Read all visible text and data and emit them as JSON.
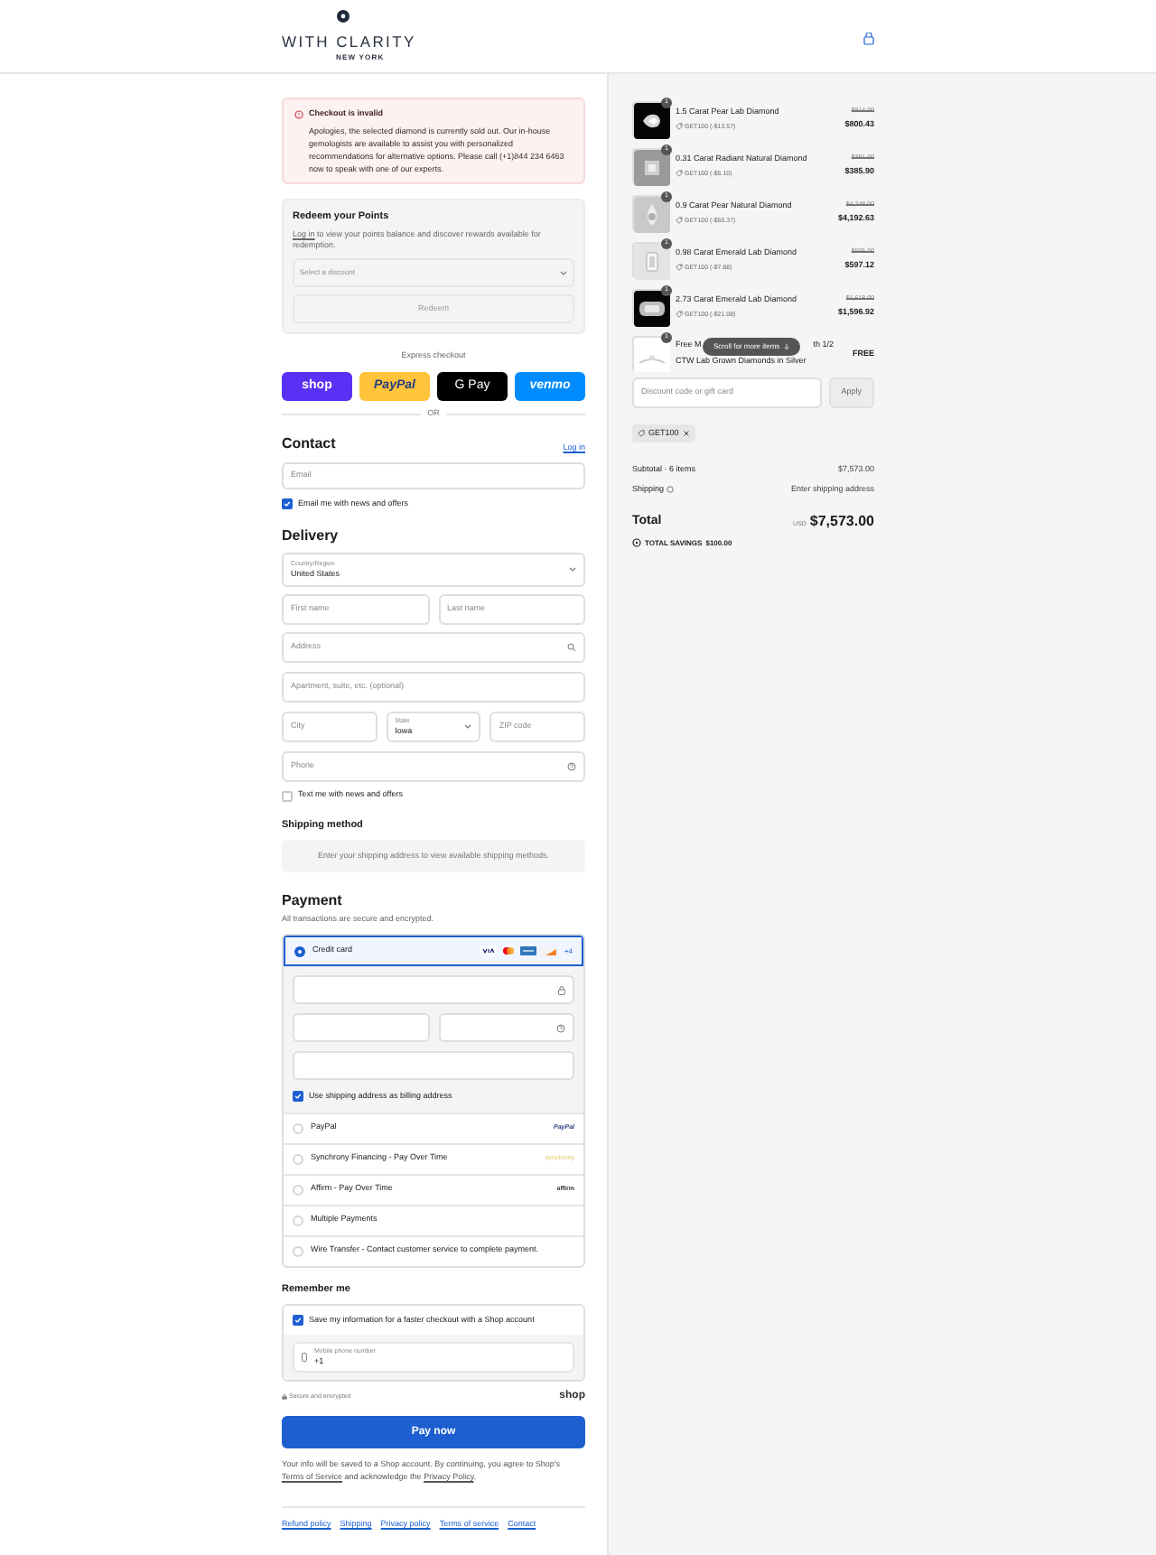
{
  "header": {
    "brand": "WITH CLARITY",
    "tagline": "NEW YORK"
  },
  "alert": {
    "title": "Checkout is invalid",
    "message": "Apologies, the selected diamond is currently sold out. Our in-house gemologists are available to assist you with personalized recommendations for alternative options. Please call (+1)844 234 6463 now to speak with one of our experts."
  },
  "redeem": {
    "title": "Redeem your Points",
    "link": "Log in",
    "text": " to view your points balance and discover rewards available for redemption.",
    "select_placeholder": "Select a discount",
    "button": "Redeem"
  },
  "express": {
    "label": "Express checkout",
    "divider": "OR",
    "buttons": [
      {
        "kind": "shop",
        "label": "shop"
      },
      {
        "kind": "paypal",
        "label": "PayPal"
      },
      {
        "kind": "gpay",
        "label": "G Pay"
      },
      {
        "kind": "venmo",
        "label": "venmo"
      }
    ]
  },
  "contact": {
    "title": "Contact",
    "login": "Log in",
    "email_placeholder": "Email",
    "newsletter": {
      "label": "Email me with news and offers",
      "checked": true
    }
  },
  "delivery": {
    "title": "Delivery",
    "country": {
      "label": "Country/Region",
      "value": "United States"
    },
    "first_name": "First name",
    "last_name": "Last name",
    "address": "Address",
    "apartment": "Apartment, suite, etc. (optional)",
    "city": "City",
    "state": {
      "label": "State",
      "value": "Iowa"
    },
    "zip": "ZIP code",
    "phone": "Phone",
    "sms": {
      "label": "Text me with news and offers",
      "checked": false
    }
  },
  "shipping_method": {
    "title": "Shipping method",
    "message": "Enter your shipping address to view available shipping methods."
  },
  "payment": {
    "title": "Payment",
    "subtitle": "All transactions are secure and encrypted.",
    "more_cards": "+4",
    "billing_same": {
      "label": "Use shipping address as billing address",
      "checked": true
    },
    "methods": [
      {
        "kind": "card",
        "label": "Credit card",
        "selected": true
      },
      {
        "kind": "plain",
        "label": "PayPal",
        "logo": "PayPal",
        "selected": false
      },
      {
        "kind": "plain",
        "label": "Synchrony Financing - Pay Over Time",
        "logo": "synchrony",
        "selected": false
      },
      {
        "kind": "plain",
        "label": "Affirm - Pay Over Time",
        "logo": "affirm",
        "selected": false
      },
      {
        "kind": "plain",
        "label": "Multiple Payments",
        "selected": false
      },
      {
        "kind": "plain",
        "label": "Wire Transfer - Contact customer service to complete payment.",
        "selected": false
      }
    ]
  },
  "remember": {
    "title": "Remember me",
    "save": {
      "label": "Save my information for a faster checkout with a Shop account",
      "checked": true
    },
    "phone": {
      "label": "Mobile phone number",
      "value": "+1"
    }
  },
  "secure_note": "Secure and encrypted",
  "shop_logo": "shop",
  "pay_button": "Pay now",
  "legal": {
    "text": "Your info will be saved to a Shop account. By continuing, you agree to Shop's ",
    "terms": "Terms of Service",
    "middle": " and acknowledge the ",
    "privacy": "Privacy Policy",
    "end": "."
  },
  "footer_links": [
    "Refund policy",
    "Shipping",
    "Privacy policy",
    "Terms of service",
    "Contact"
  ],
  "cart": {
    "items": [
      {
        "name": "1.5 Carat Pear Lab Diamond",
        "qty": "1",
        "discount": "GET100 (-$13.57)",
        "original_price": "$814.00",
        "price": "$800.43"
      },
      {
        "name": "0.31 Carat Radiant Natural Diamond",
        "qty": "1",
        "discount": "GET100 (-$5.10)",
        "original_price": "$391.00",
        "price": "$385.90"
      },
      {
        "name": "0.9 Carat Pear Natural Diamond",
        "qty": "1",
        "discount": "GET100 (-$55.37)",
        "original_price": "$4,248.00",
        "price": "$4,192.63"
      },
      {
        "name": "0.98 Carat Emerald Lab Diamond",
        "qty": "1",
        "discount": "GET100 (-$7.88)",
        "original_price": "$605.00",
        "price": "$597.12"
      },
      {
        "name": "2.73 Carat Emerald Lab Diamond",
        "qty": "1",
        "discount": "GET100 (-$21.08)",
        "original_price": "$1,618.00",
        "price": "$1,596.92"
      }
    ],
    "last_item": {
      "name_start": "Free M",
      "name_end": "th 1/2",
      "name_line2": "CTW Lab Grown Diamonds in Silver",
      "qty": "1",
      "price": "FREE"
    },
    "scroll_hint": "Scroll for more items",
    "discount_placeholder": "Discount code or gift card",
    "apply": "Apply",
    "applied_code": "GET100",
    "subtotal_label": "Subtotal · 6 items",
    "subtotal": "$7,573.00",
    "shipping_label": "Shipping",
    "shipping_value": "Enter shipping address",
    "total_label": "Total",
    "currency": "USD",
    "total": "$7,573.00",
    "savings_label": "TOTAL SAVINGS",
    "savings": "$100.00"
  }
}
